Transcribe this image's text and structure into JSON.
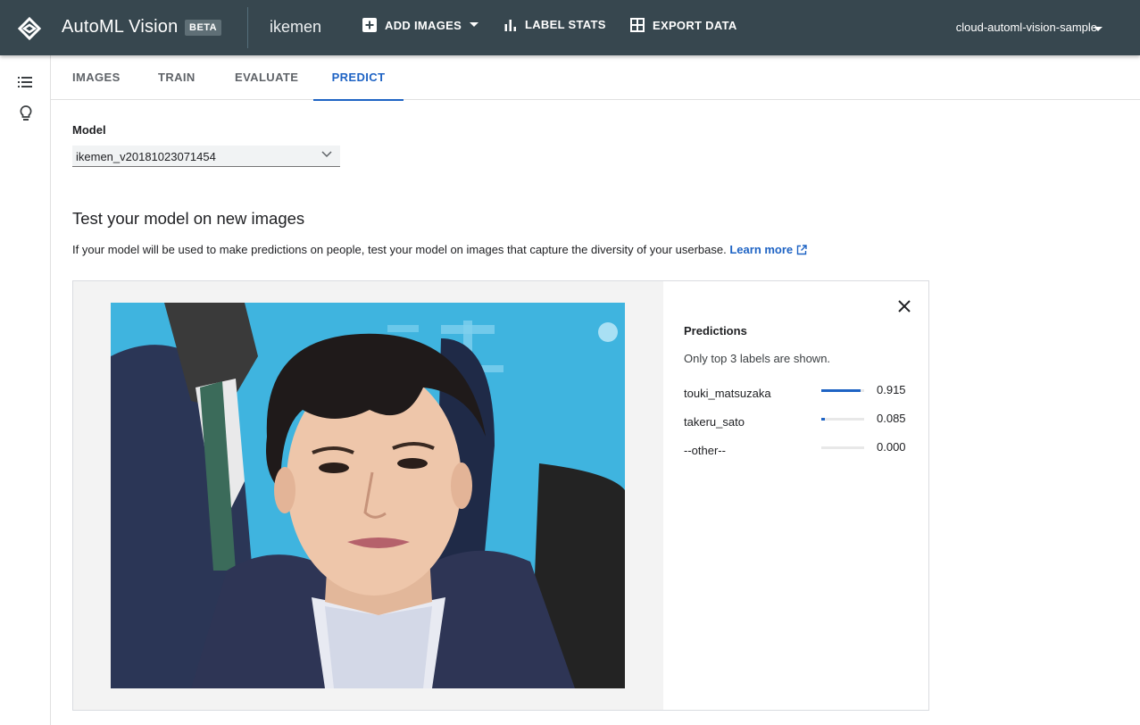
{
  "header": {
    "product": "AutoML Vision",
    "beta": "BETA",
    "dataset": "ikemen",
    "add_images": "ADD IMAGES",
    "label_stats": "LABEL STATS",
    "export_data": "EXPORT DATA",
    "account": "cloud-automl-vision-sample",
    "bg_color": "#37474f"
  },
  "tabs": [
    {
      "label": "IMAGES",
      "active": false
    },
    {
      "label": "TRAIN",
      "active": false
    },
    {
      "label": "EVALUATE",
      "active": false
    },
    {
      "label": "PREDICT",
      "active": true
    }
  ],
  "model": {
    "label": "Model",
    "selected": "ikemen_v20181023071454"
  },
  "section": {
    "heading": "Test your model on new images",
    "description": "If your model will be used to make predictions on people, test your model on images that capture the diversity of your userbase.",
    "learn_more": "Learn more"
  },
  "predictions": {
    "title": "Predictions",
    "note": "Only top 3 labels are shown.",
    "items": [
      {
        "label": "touki_matsuzaka",
        "score": "0.915",
        "value": 0.915
      },
      {
        "label": "takeru_sato",
        "score": "0.085",
        "value": 0.085
      },
      {
        "label": "--other--",
        "score": "0.000",
        "value": 0.0
      }
    ]
  },
  "icons": [
    "automl-logo-icon",
    "add-box-icon",
    "caret-down-icon",
    "bar-chart-icon",
    "grid-icon",
    "list-icon",
    "lightbulb-icon",
    "chevron-down-icon",
    "open-in-new-icon",
    "close-icon"
  ],
  "colors": {
    "accent": "#1e63c4",
    "image_bg": "#3fb4df"
  }
}
